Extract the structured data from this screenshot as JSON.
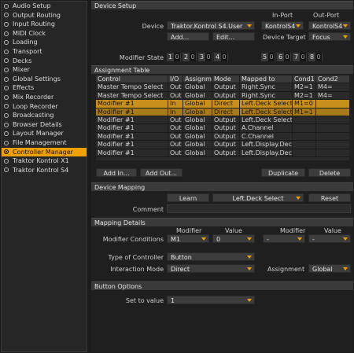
{
  "sidebar": {
    "items": [
      {
        "label": "Audio Setup",
        "active": false
      },
      {
        "label": "Output Routing",
        "active": false
      },
      {
        "label": "Input Routing",
        "active": false
      },
      {
        "label": "MIDI Clock",
        "active": false
      },
      {
        "label": "Loading",
        "active": false
      },
      {
        "label": "Transport",
        "active": false
      },
      {
        "label": "Decks",
        "active": false
      },
      {
        "label": "Mixer",
        "active": false
      },
      {
        "label": "Global Settings",
        "active": false
      },
      {
        "label": "Effects",
        "active": false
      },
      {
        "label": "Mix Recorder",
        "active": false
      },
      {
        "label": "Loop Recorder",
        "active": false
      },
      {
        "label": "Broadcasting",
        "active": false
      },
      {
        "label": "Browser Details",
        "active": false
      },
      {
        "label": "Layout Manager",
        "active": false
      },
      {
        "label": "File Management",
        "active": false
      },
      {
        "label": "Controller Manager",
        "active": true
      },
      {
        "label": "Traktor Kontrol X1",
        "active": false
      },
      {
        "label": "Traktor Kontrol S4",
        "active": false
      }
    ]
  },
  "device_setup": {
    "title": "Device Setup",
    "in_port_label": "In-Port",
    "out_port_label": "Out-Port",
    "device_label": "Device",
    "device_value": "Traktor.Kontrol S4.User",
    "in_port_value": "KontrolS4",
    "out_port_value": "KontrolS4",
    "add_button": "Add...",
    "edit_button": "Edit...",
    "device_target_label": "Device Target",
    "device_target_value": "Focus",
    "modifier_state_label": "Modifier State",
    "modifiers": [
      {
        "num": "1",
        "val": "0"
      },
      {
        "num": "2",
        "val": "0"
      },
      {
        "num": "3",
        "val": "0"
      },
      {
        "num": "4",
        "val": "0"
      },
      {
        "num": "5",
        "val": "0"
      },
      {
        "num": "6",
        "val": "0"
      },
      {
        "num": "7",
        "val": "0"
      },
      {
        "num": "8",
        "val": "0"
      }
    ]
  },
  "assignment_table": {
    "title": "Assignment Table",
    "columns": [
      "Control",
      "I/O",
      "Assignment",
      "Mode",
      "Mapped to",
      "Cond1",
      "Cond2"
    ],
    "rows": [
      {
        "cells": [
          "Master Tempo Select",
          "Out",
          "Global",
          "Output",
          "Right.Sync",
          "M2=1",
          "M4="
        ],
        "state": "normal"
      },
      {
        "cells": [
          "Master Tempo Select",
          "Out",
          "Global",
          "Output",
          "Right.Sync",
          "M2=1",
          "M4="
        ],
        "state": "normal"
      },
      {
        "cells": [
          "Modifier #1",
          "In",
          "Global",
          "Direct",
          "Left.Deck Select",
          "M1=0",
          ""
        ],
        "state": "selected"
      },
      {
        "cells": [
          "Modifier #1",
          "In",
          "Global",
          "Direct",
          "Left.Deck Select",
          "M1=1",
          ""
        ],
        "state": "selected2"
      },
      {
        "cells": [
          "Modifier #1",
          "Out",
          "Global",
          "Output",
          "Left.Deck Select",
          "",
          ""
        ],
        "state": "normal"
      },
      {
        "cells": [
          "Modifier #1",
          "Out",
          "Global",
          "Output",
          "A.Channel",
          "",
          ""
        ],
        "state": "normal"
      },
      {
        "cells": [
          "Modifier #1",
          "Out",
          "Global",
          "Output",
          "C.Channel",
          "",
          ""
        ],
        "state": "normal"
      },
      {
        "cells": [
          "Modifier #1",
          "Out",
          "Global",
          "Output",
          "Left.Display.Dec",
          "",
          ""
        ],
        "state": "normal"
      },
      {
        "cells": [
          "Modifier #1",
          "Out",
          "Global",
          "Output",
          "Left.Display.Dec",
          "",
          ""
        ],
        "state": "normal"
      }
    ],
    "add_in_button": "Add In...",
    "add_out_button": "Add Out...",
    "duplicate_button": "Duplicate",
    "delete_button": "Delete"
  },
  "device_mapping": {
    "title": "Device Mapping",
    "learn_button": "Learn",
    "mapping_value": "Left.Deck Select",
    "reset_button": "Reset",
    "comment_label": "Comment",
    "comment_value": ""
  },
  "mapping_details": {
    "title": "Mapping Details",
    "modifier_header_1": "Modifier",
    "value_header_1": "Value",
    "modifier_header_2": "Modifier",
    "value_header_2": "Value",
    "modifier_conditions_label": "Modifier Conditions",
    "cond1_modifier": "M1",
    "cond1_value": "0",
    "cond2_modifier": "-",
    "cond2_value": "-",
    "type_label": "Type of Controller",
    "type_value": "Button",
    "interaction_label": "Interaction Mode",
    "interaction_value": "Direct",
    "assignment_label": "Assignment",
    "assignment_value": "Global"
  },
  "button_options": {
    "title": "Button Options",
    "set_to_value_label": "Set to value",
    "set_to_value": "1"
  },
  "colors": {
    "accent": "#f0a100",
    "background": "#1f1f1f",
    "panel_header": "#3a3a3a"
  }
}
